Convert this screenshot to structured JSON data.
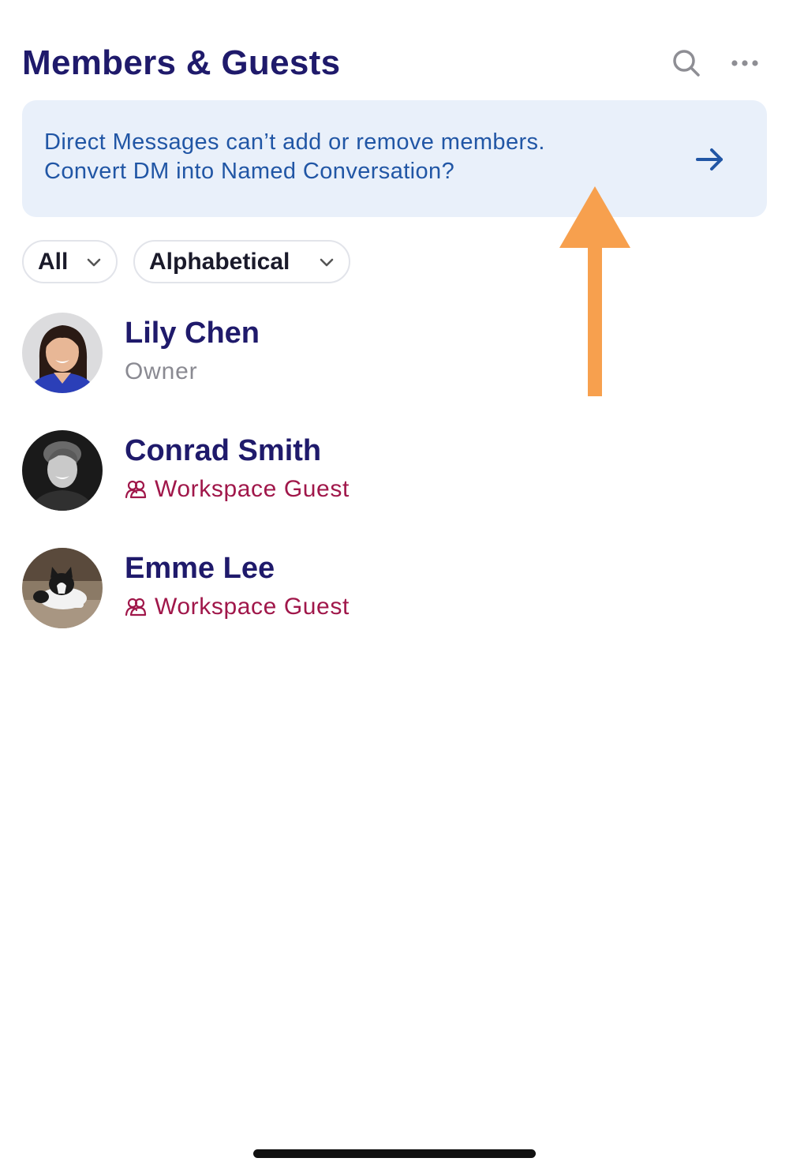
{
  "header": {
    "title": "Members & Guests",
    "search_icon": "search-icon",
    "more_icon": "more-horizontal-icon"
  },
  "banner": {
    "line1": "Direct Messages can’t add or remove members.",
    "line2": "Convert DM into Named Conversation?",
    "arrow_icon": "arrow-right-icon"
  },
  "filters": {
    "scope_label": "All",
    "sort_label": "Alphabetical"
  },
  "members": [
    {
      "name": "Lily Chen",
      "role": "Owner"
    },
    {
      "name": "Conrad Smith",
      "role": "Workspace Guest"
    },
    {
      "name": "Emme Lee",
      "role": "Workspace Guest"
    }
  ],
  "colors": {
    "title": "#1f1a6b",
    "banner_bg": "#e9f0fa",
    "banner_text": "#2156a5",
    "guest_role": "#a0174a",
    "annotation_arrow": "#f7a04e"
  }
}
